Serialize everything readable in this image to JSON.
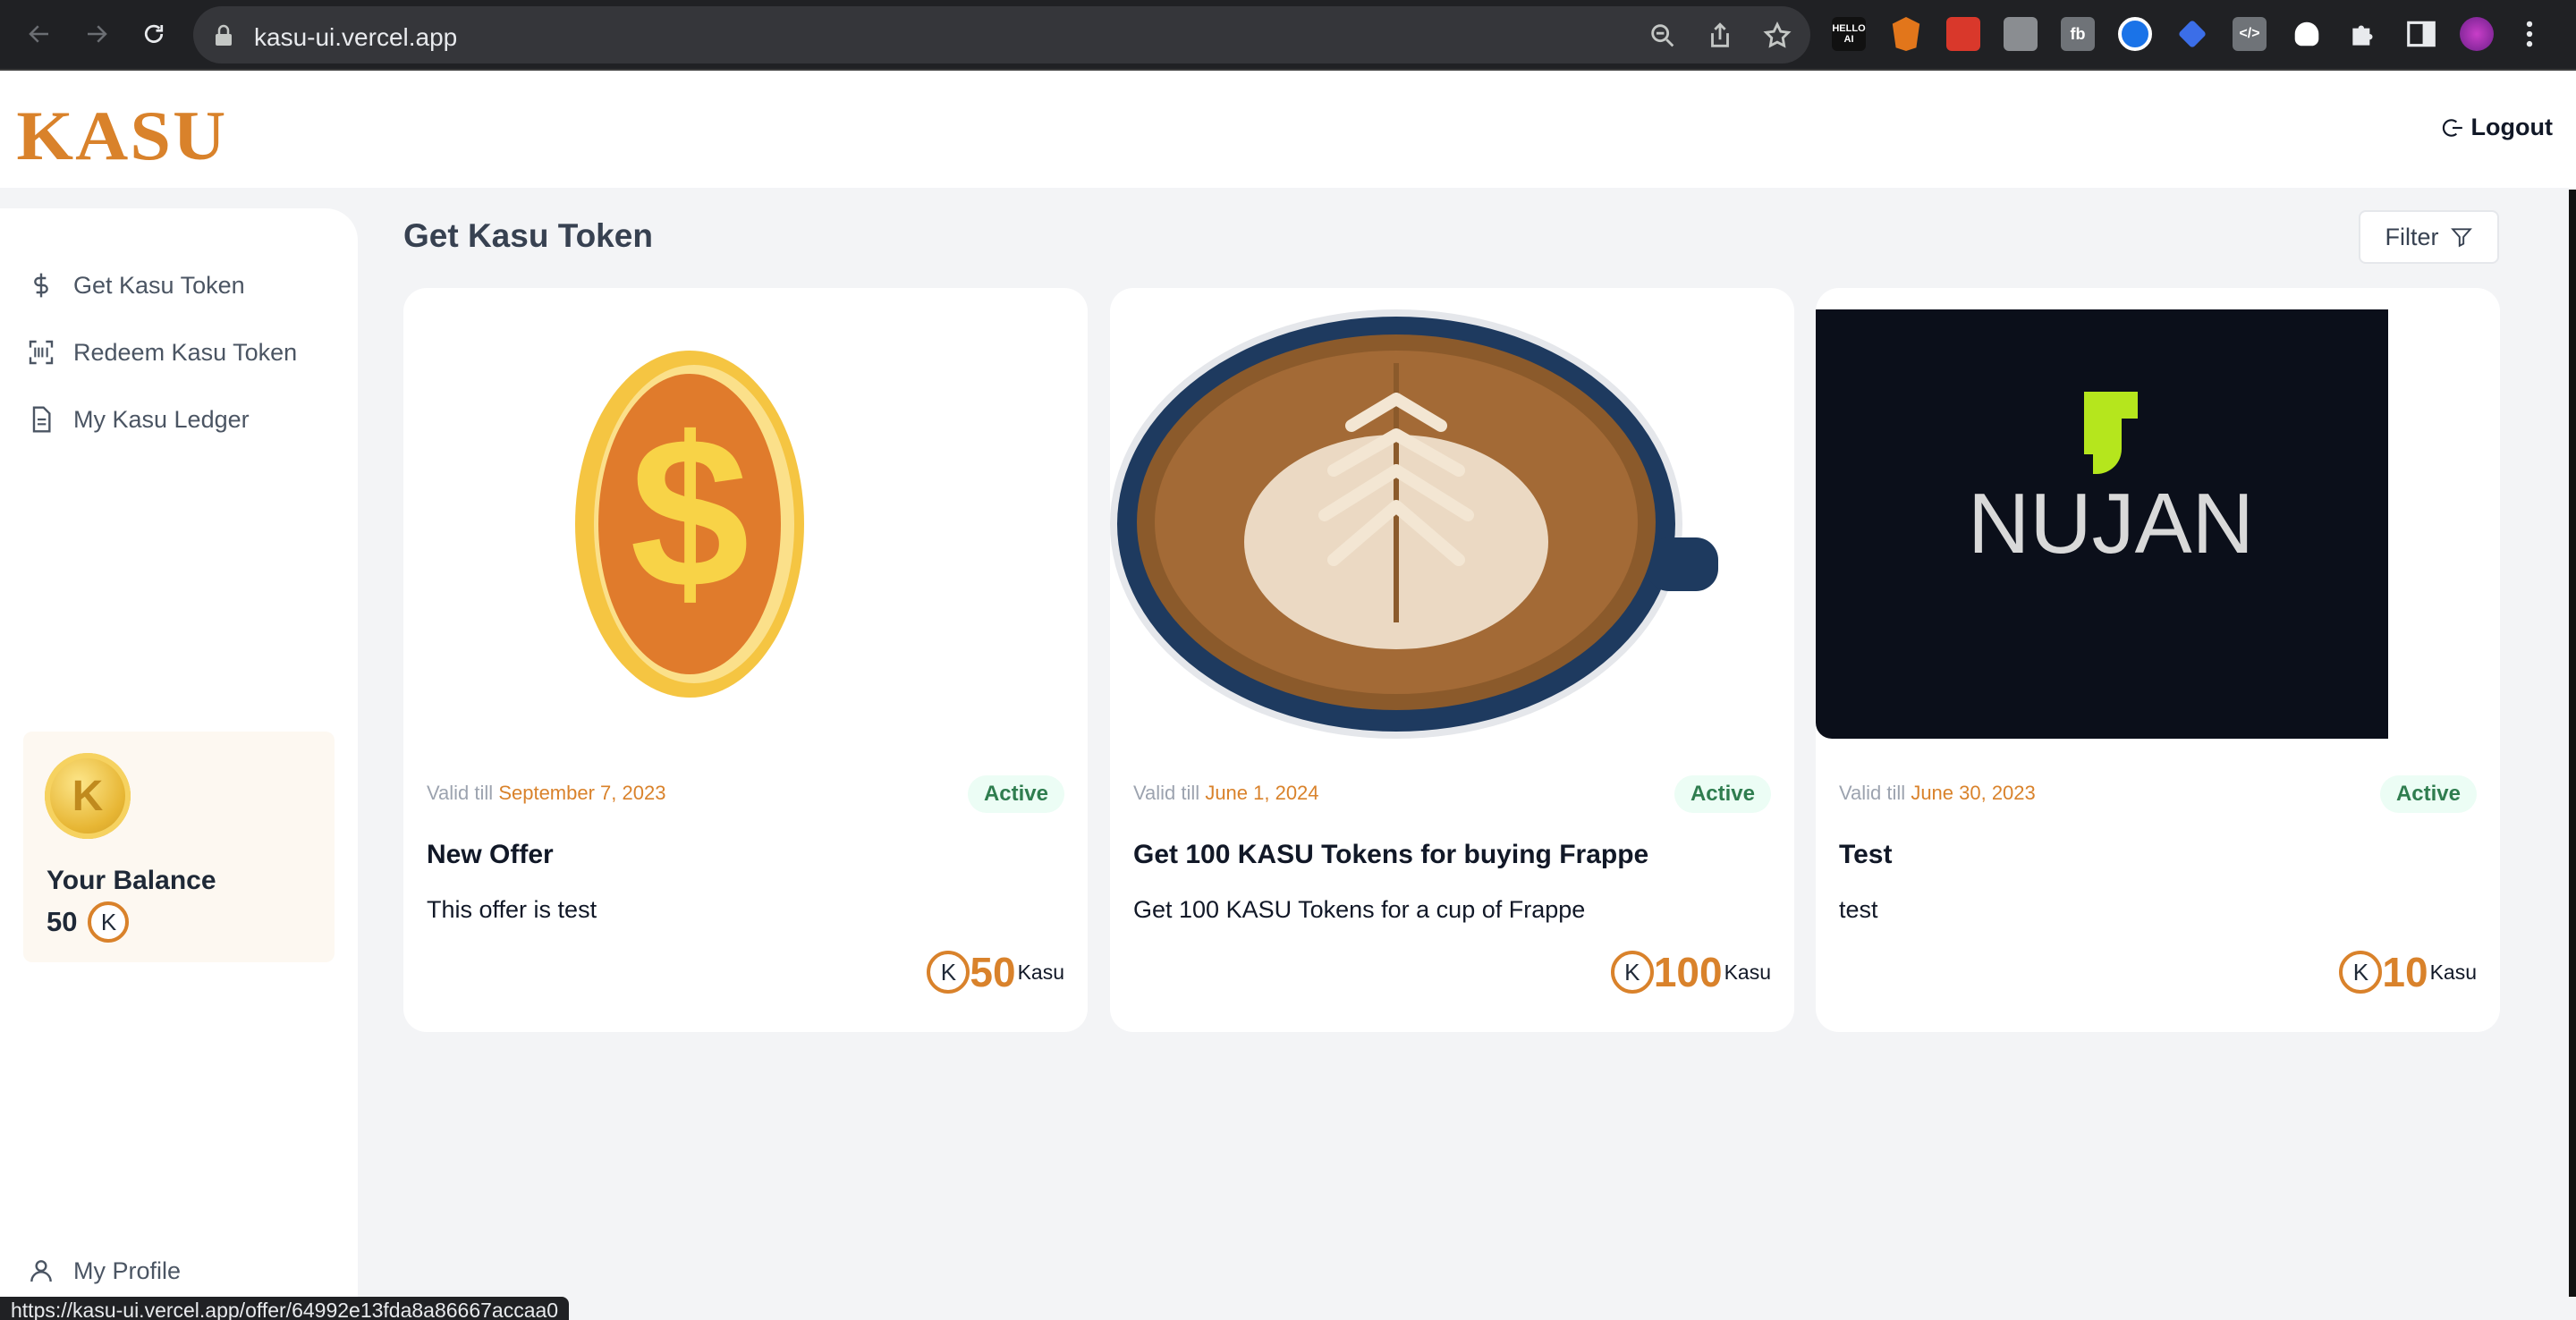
{
  "browser": {
    "url": "kasu-ui.vercel.app",
    "status_url": "https://kasu-ui.vercel.app/offer/64992e13fda8a86667accaa0",
    "extensions": [
      "code-ai-ext",
      "metamask-ext",
      "pixel-ext",
      "hand-ext",
      "fb-ext",
      "eye-ext",
      "tag-ext",
      "code-ext",
      "ghost-ext",
      "puzzle-ext",
      "sidebar-ext"
    ],
    "ext_label_code": "HELLO\nAI",
    "ext_label_fb": "fb"
  },
  "header": {
    "logo": "KASU",
    "logout_label": "Logout"
  },
  "sidebar": {
    "items": [
      {
        "label": "Get Kasu Token",
        "icon": "dollar-icon"
      },
      {
        "label": "Redeem Kasu Token",
        "icon": "scan-icon"
      },
      {
        "label": "My Kasu Ledger",
        "icon": "document-icon"
      }
    ],
    "balance": {
      "title": "Your Balance",
      "value": "50",
      "coin_letter": "K"
    },
    "profile_label": "My Profile"
  },
  "main": {
    "title": "Get Kasu Token",
    "filter_label": "Filter",
    "valid_prefix": "Valid till",
    "token_letter": "K",
    "offers": [
      {
        "image": "gold-dollar-coin",
        "valid_date": "September 7, 2023",
        "status": "Active",
        "title": "New Offer",
        "description": "This offer is test",
        "amount": "50",
        "unit": "Kasu"
      },
      {
        "image": "latte-art-coffee",
        "valid_date": "June 1, 2024",
        "status": "Active",
        "title": "Get 100 KASU Tokens for buying Frappe",
        "description": "Get 100 KASU Tokens for a cup of Frappe",
        "amount": "100",
        "unit": "Kasu"
      },
      {
        "image": "nujan-logo",
        "valid_date": "June 30, 2023",
        "status": "Active",
        "title": "Test",
        "description": "test",
        "amount": "10",
        "unit": "Kasu",
        "image_text": "NUJAN"
      }
    ]
  },
  "colors": {
    "brand": "#d9822b",
    "active_bg": "#ecfdf5",
    "active_text": "#2f7d4f",
    "nujan_bg": "#0b0f1a",
    "nujan_green": "#b5e61d"
  }
}
